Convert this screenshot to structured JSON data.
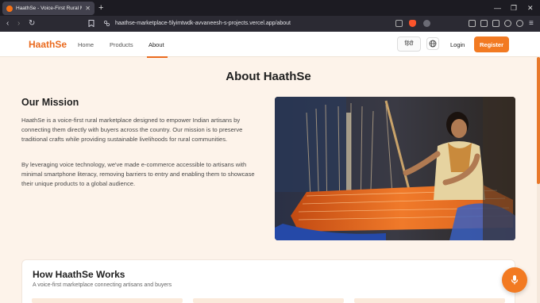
{
  "browser": {
    "tab_title": "HaathSe - Voice-First Rural Ma",
    "url": "haathse-marketplace-5lyimtwdk-avvaneesh-s-projects.vercel.app/about"
  },
  "header": {
    "logo": "HaathSe",
    "nav": [
      {
        "label": "Home"
      },
      {
        "label": "Products"
      },
      {
        "label": "About",
        "active": true
      }
    ],
    "language_label": "हिंदी",
    "login_label": "Login",
    "register_label": "Register"
  },
  "page": {
    "title": "About HaathSe",
    "mission": {
      "heading": "Our Mission",
      "paragraph1": "HaathSe is a voice-first rural marketplace designed to empower Indian artisans by connecting them directly with buyers across the country. Our mission is to preserve traditional crafts while providing sustainable livelihoods for rural communities.",
      "paragraph2": "By leveraging voice technology, we've made e-commerce accessible to artisans with minimal smartphone literacy, removing barriers to entry and enabling them to showcase their unique products to a global audience."
    },
    "how_it_works": {
      "heading": "How HaathSe Works",
      "subtitle": "A voice-first marketplace connecting artisans and buyers"
    }
  },
  "colors": {
    "accent": "#f27a22",
    "background": "#fdf3ea"
  },
  "icons": {
    "globe": "globe-icon",
    "mic": "microphone-icon"
  }
}
